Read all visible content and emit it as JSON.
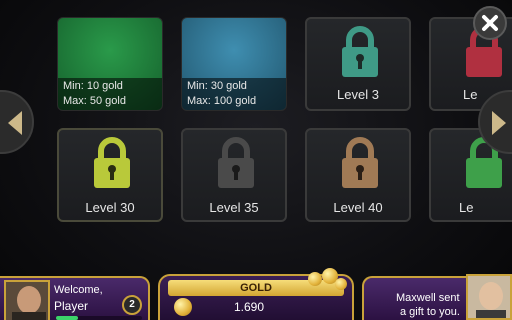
{
  "tables": [
    {
      "type": "unlocked",
      "min": "Min: 10 gold",
      "max": "Max: 50 gold",
      "felt_color": "#1f7a3a"
    },
    {
      "type": "unlocked",
      "min": "Min: 30 gold",
      "max": "Max: 100 gold",
      "felt_color": "#2f6f8f"
    },
    {
      "type": "locked",
      "label": "Level 3",
      "lock_color": "#3f9a86"
    },
    {
      "type": "locked",
      "label": "Le",
      "lock_color": "#b03040"
    },
    {
      "type": "locked",
      "label": "Level 30",
      "lock_color": "#b9c93a"
    },
    {
      "type": "locked",
      "label": "Level 35",
      "lock_color": "#4a4a4a"
    },
    {
      "type": "locked",
      "label": "Level 40",
      "lock_color": "#a07a55"
    },
    {
      "type": "locked",
      "label": "Le",
      "lock_color": "#3ea04a"
    }
  ],
  "nav": {
    "left": "arrow-left-icon",
    "right": "arrow-right-icon",
    "close": "close-icon"
  },
  "player": {
    "greeting": "Welcome,",
    "name": "Player",
    "level": "2",
    "xp_fraction": 0.25
  },
  "gold": {
    "label": "GOLD",
    "amount": "1.690"
  },
  "gift": {
    "line1": "Maxwell sent",
    "line2": "a gift to you."
  },
  "colors": {
    "accent_gold": "#c9a23a",
    "panel_purple": "#3b1f55"
  }
}
